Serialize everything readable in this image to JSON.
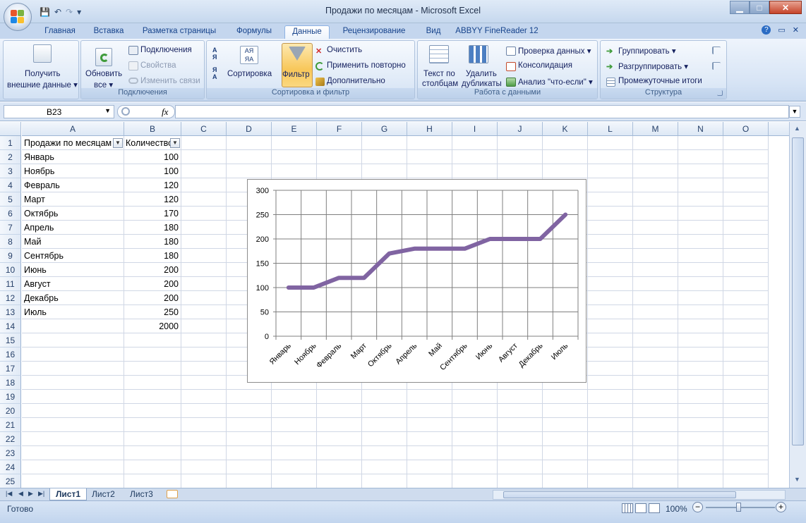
{
  "window": {
    "title": "Продажи по месяцам - Microsoft Excel",
    "min": "▁",
    "max": "□",
    "close": "✕"
  },
  "qat": {
    "save": "💾",
    "undo": "↶",
    "redo": "↷",
    "more": "▾"
  },
  "tabs": [
    "Главная",
    "Вставка",
    "Разметка страницы",
    "Формулы",
    "Данные",
    "Рецензирование",
    "Вид",
    "ABBYY FineReader 12"
  ],
  "active_tab": "Данные",
  "ribbon": {
    "external": {
      "line1": "Получить",
      "line2": "внешние данные ▾"
    },
    "connections": {
      "refresh1": "Обновить",
      "refresh2": "все ▾",
      "conn": "Подключения",
      "props": "Свойства",
      "links": "Изменить связи",
      "label": "Подключения"
    },
    "sort": {
      "sort": "Сортировка",
      "filter": "Фильтр",
      "clear": "Очистить",
      "reapply": "Применить повторно",
      "advanced": "Дополнительно",
      "label": "Сортировка и фильтр",
      "az": "А\nЯ",
      "za": "Я\nА"
    },
    "datatools": {
      "text1": "Текст по",
      "text2": "столбцам",
      "dup1": "Удалить",
      "dup2": "дубликаты",
      "validate": "Проверка данных ▾",
      "consolidate": "Консолидация",
      "whatif": "Анализ \"что-если\" ▾",
      "label": "Работа с данными"
    },
    "outline": {
      "group": "Группировать ▾",
      "ungroup": "Разгруппировать ▾",
      "subtotal": "Промежуточные итоги",
      "label": "Структура"
    }
  },
  "formula_bar": {
    "name_box": "B23",
    "fx": "fx",
    "value": ""
  },
  "columns": [
    "A",
    "B",
    "C",
    "D",
    "E",
    "F",
    "G",
    "H",
    "I",
    "J",
    "K",
    "L",
    "M",
    "N",
    "O"
  ],
  "rows": [
    "1",
    "2",
    "3",
    "4",
    "5",
    "6",
    "7",
    "8",
    "9",
    "10",
    "11",
    "12",
    "13",
    "14",
    "15",
    "16",
    "17",
    "18",
    "19",
    "20",
    "21",
    "22",
    "23",
    "24",
    "25"
  ],
  "table": {
    "header_a": "Продажи по месяцам",
    "header_b": "Количество",
    "months": [
      "Январь",
      "Ноябрь",
      "Февраль",
      "Март",
      "Октябрь",
      "Апрель",
      "Май",
      "Сентябрь",
      "Июнь",
      "Август",
      "Декабрь",
      "Июль"
    ],
    "values": [
      "100",
      "100",
      "120",
      "120",
      "170",
      "180",
      "180",
      "180",
      "200",
      "200",
      "200",
      "250"
    ],
    "total": "2000"
  },
  "chart_data": {
    "type": "line",
    "categories": [
      "Январь",
      "Ноябрь",
      "Февраль",
      "Март",
      "Октябрь",
      "Апрель",
      "Май",
      "Сентябрь",
      "Июнь",
      "Август",
      "Декабрь",
      "Июль"
    ],
    "series": [
      {
        "values": [
          100,
          100,
          120,
          120,
          170,
          180,
          180,
          180,
          200,
          200,
          200,
          250
        ],
        "color": "#8064a2"
      }
    ],
    "ylim": [
      0,
      300
    ],
    "yticks": [
      "0",
      "50",
      "100",
      "150",
      "200",
      "250",
      "300"
    ],
    "grid": true,
    "legend": "none"
  },
  "sheets": [
    "Лист1",
    "Лист2",
    "Лист3"
  ],
  "active_sheet": "Лист1",
  "status": {
    "ready": "Готово",
    "zoom": "100%",
    "zoom_out": "−",
    "zoom_in": "+"
  }
}
